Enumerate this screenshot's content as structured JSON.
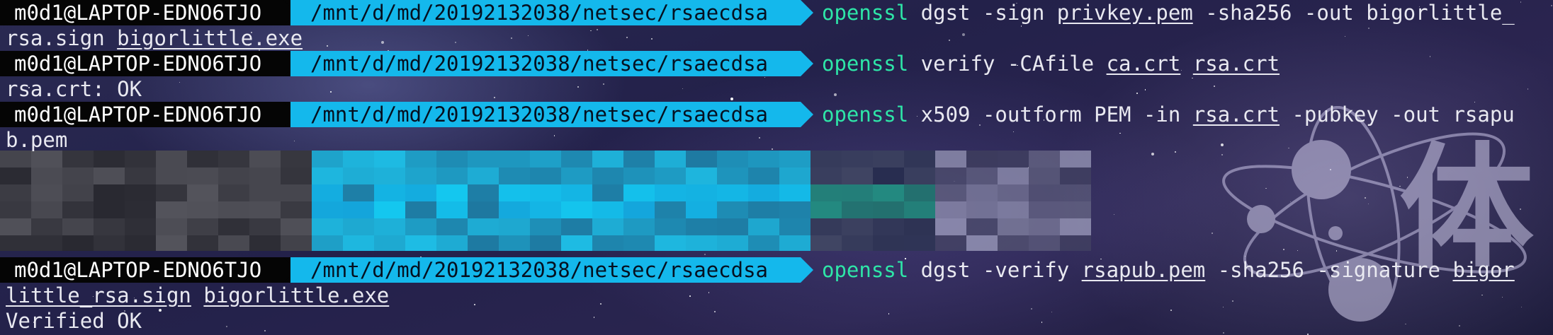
{
  "prompt": {
    "host": "m0d1@LAPTOP-EDNO6TJO",
    "path": "/mnt/d/md/20192132038/netsec/rsaecdsa"
  },
  "lines": [
    {
      "bin": "openssl",
      "tokens": [
        {
          "t": " dgst -sign "
        },
        {
          "t": "privkey.pem",
          "u": true
        },
        {
          "t": " -sha256 -out bigorlittle_"
        }
      ],
      "wrap": [
        {
          "t": "rsa.sign "
        },
        {
          "t": "bigorlittle.exe",
          "u": true
        }
      ]
    },
    {
      "bin": "openssl",
      "tokens": [
        {
          "t": " verify -CAfile "
        },
        {
          "t": "ca.crt",
          "u": true
        },
        {
          "t": " "
        },
        {
          "t": "rsa.crt",
          "u": true
        }
      ],
      "output": "rsa.crt: OK"
    },
    {
      "bin": "openssl",
      "tokens": [
        {
          "t": " x509 -outform PEM -in "
        },
        {
          "t": "rsa.crt",
          "u": true
        },
        {
          "t": " -pubkey -out rsapu"
        }
      ],
      "wrap": [
        {
          "t": "b.pem"
        }
      ]
    },
    {
      "bin": "openssl",
      "tokens": [
        {
          "t": " dgst -verify "
        },
        {
          "t": "rsapub.pem",
          "u": true
        },
        {
          "t": " -sha256 -signature "
        },
        {
          "t": "bigor",
          "u": true
        }
      ],
      "wrap": [
        {
          "t": "little_rsa.sign",
          "u": true
        },
        {
          "t": " "
        },
        {
          "t": "bigorlittle.exe",
          "u": true
        }
      ],
      "output": "Verified OK"
    }
  ],
  "watermark": {
    "glyph": "体",
    "color": "#d8d4ee"
  },
  "colors": {
    "host_bg": "#050505",
    "path_bg": "#14b8ec",
    "bin": "#2ee6a8"
  }
}
